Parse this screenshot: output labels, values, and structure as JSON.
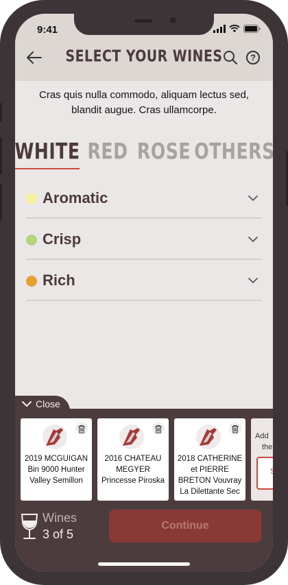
{
  "status_bar": {
    "time": "9:41"
  },
  "header": {
    "title": "SELECT YOUR WINES"
  },
  "intro": {
    "text": "Cras quis nulla commodo, aliquam lectus sed, blandit augue. Cras ullamcorpe."
  },
  "tabs": [
    {
      "label": "WHITE",
      "active": true
    },
    {
      "label": "RED",
      "active": false
    },
    {
      "label": "ROSE",
      "active": false
    },
    {
      "label": "OTHERS",
      "active": false
    }
  ],
  "categories": [
    {
      "name": "Aromatic",
      "color": "#f6f0a0"
    },
    {
      "name": "Crisp",
      "color": "#b6d37e"
    },
    {
      "name": "Rich",
      "color": "#e3a232"
    }
  ],
  "tray": {
    "close_label": "Close",
    "cards": [
      {
        "line1": "2019 MCGUIGAN",
        "line2": "Bin 9000 Hunter",
        "line3": "Valley Semillon"
      },
      {
        "line1": "2016 CHATEAU",
        "line2": "MEGYER",
        "line3": "Princesse Piroska"
      },
      {
        "line1": "2018 CATHERINE",
        "line2": "et PIERRE",
        "line3": "BRETON Vouvray",
        "line4": "La Dilettante Sec"
      }
    ],
    "add_text_line1": "Add",
    "add_text_line2": "the",
    "add_button_text": "S"
  },
  "footer": {
    "wines_label": "Wines",
    "wines_count": "3 of 5",
    "continue_label": "Continue"
  },
  "colors": {
    "accent": "#c94a3a",
    "tray": "#4c3c3e",
    "continue_bg": "#8a3a36",
    "title": "#4b3a3d"
  },
  "icons": {
    "back": "arrow-left-icon",
    "search": "search-icon",
    "help": "help-icon",
    "chevron": "chevron-down-icon",
    "trash": "trash-icon",
    "glass": "wine-glass-icon"
  }
}
